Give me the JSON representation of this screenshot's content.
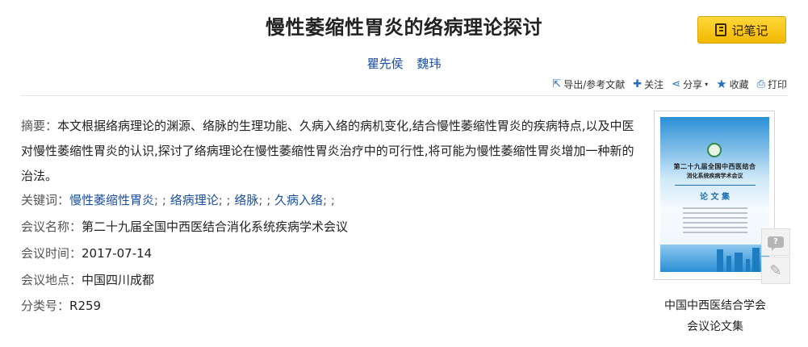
{
  "article": {
    "title": "慢性萎缩性胃炎的络病理论探讨",
    "authors": [
      "瞿先侯",
      "魏玮"
    ],
    "note_button": "记笔记"
  },
  "toolbar": {
    "export": "导出/参考文献",
    "follow": "关注",
    "share": "分享",
    "favorite": "收藏",
    "print": "打印"
  },
  "abstract": {
    "label": "摘要：",
    "text": "本文根据络病理论的渊源、络脉的生理功能、久病入络的病机变化,结合慢性萎缩性胃炎的疾病特点,以及中医对慢性萎缩性胃炎的认识,探讨了络病理论在慢性萎缩性胃炎治疗中的可行性,将可能为慢性萎缩性胃炎增加一种新的治法。"
  },
  "keywords": {
    "label": "关键词：",
    "items": [
      "慢性萎缩性胃炎",
      "络病理论",
      "络脉",
      "久病入络"
    ]
  },
  "meta": {
    "conference_label": "会议名称：",
    "conference": "第二十九届全国中西医结合消化系统疾病学术会议",
    "date_label": "会议时间：",
    "date": "2017-07-14",
    "place_label": "会议地点：",
    "place": "中国四川成都",
    "class_label": "分类号：",
    "class": "R259"
  },
  "cover": {
    "line1": "第二十九届全国中西医结合",
    "line2": "消化系统疾病学术会议",
    "line3": "论 文 集"
  },
  "journal": {
    "line1": "中国中西医结合学会",
    "line2": "会议论文集"
  },
  "side_icons": [
    "comment-icon",
    "edit-pencil-icon"
  ]
}
